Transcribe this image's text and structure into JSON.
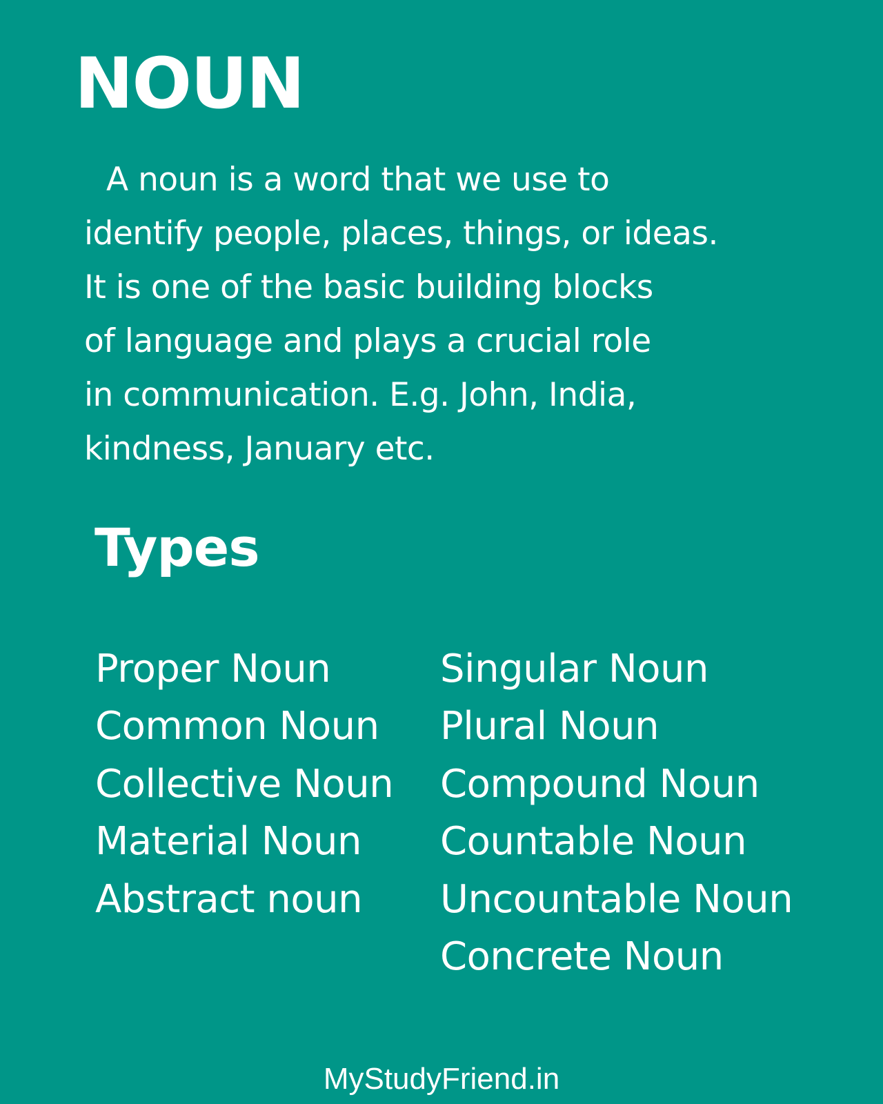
{
  "title": "NOUN",
  "definition": {
    "lines": [
      "A noun is a word that we use to",
      "identify people, places, things, or ideas.",
      "It is one of the basic building blocks",
      "of language and plays a crucial role",
      "in communication. E.g. John, India,",
      "kindness, January etc."
    ]
  },
  "types": {
    "heading": "Types",
    "left": [
      "Proper Noun",
      "Common Noun",
      "Collective Noun",
      "Material Noun",
      "Abstract noun"
    ],
    "right": [
      "Singular Noun",
      "Plural Noun",
      "Compound Noun",
      "Countable Noun",
      "Uncountable Noun",
      "Concrete Noun"
    ]
  },
  "footer": "MyStudyFriend.in",
  "colors": {
    "background": "#009688",
    "text": "#ffffff"
  }
}
